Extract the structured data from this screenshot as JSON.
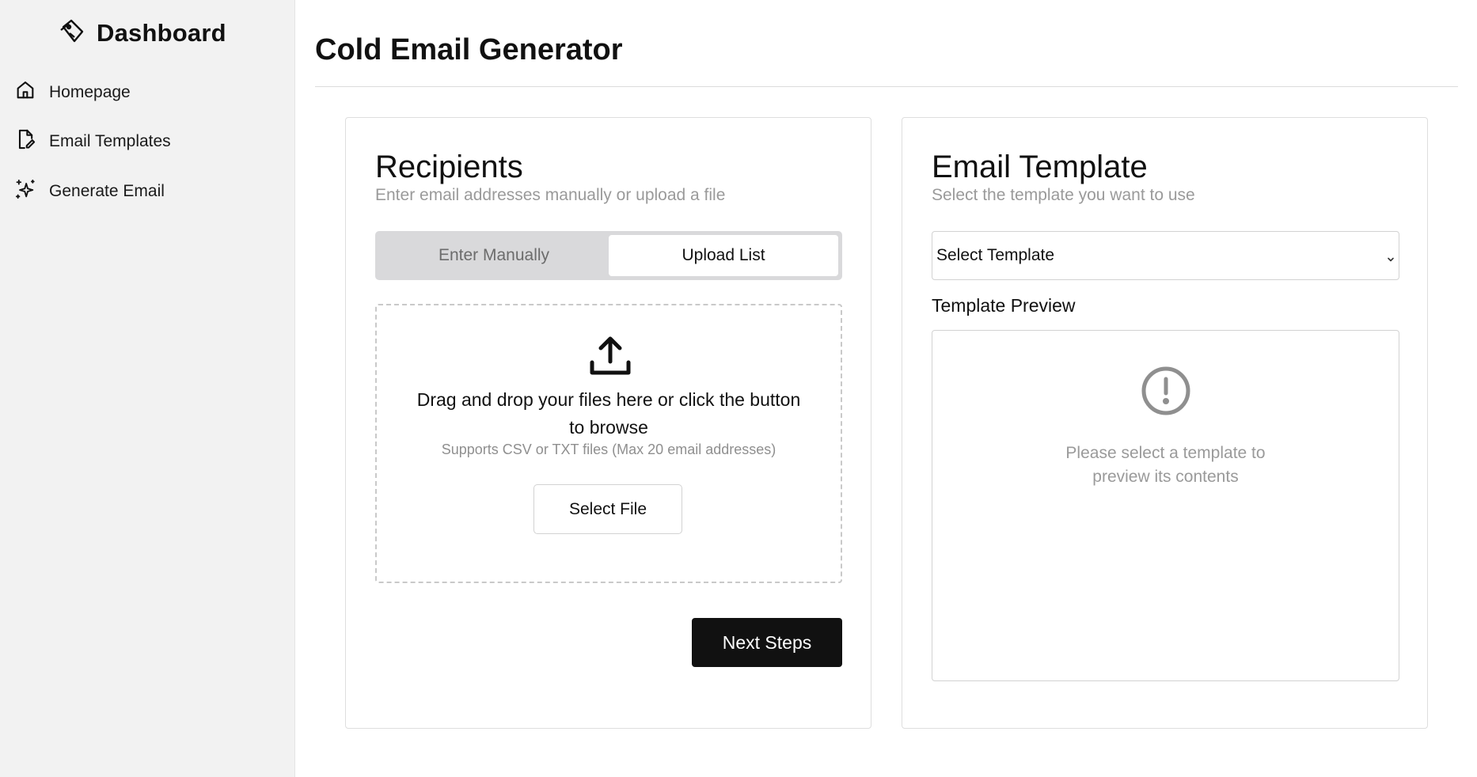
{
  "sidebar": {
    "brand": {
      "title": "Dashboard",
      "icon": "tag-logo-icon"
    },
    "items": [
      {
        "label": "Homepage",
        "icon": "home-icon"
      },
      {
        "label": "Email Templates",
        "icon": "file-edit-icon"
      },
      {
        "label": "Generate Email",
        "icon": "sparkles-icon"
      }
    ]
  },
  "main": {
    "title": "Cold Email Generator",
    "recipients": {
      "title": "Recipients",
      "subtitle": "Enter email addresses manually or upload a file",
      "tabs": [
        {
          "label": "Enter Manually",
          "active": false
        },
        {
          "label": "Upload List",
          "active": true
        }
      ],
      "dropzone": {
        "icon": "upload-icon",
        "main_text": "Drag and drop your files here or click the button to browse",
        "sub_text": "Supports CSV or TXT files (Max 20 email addresses)",
        "button_label": "Select File"
      },
      "next_label": "Next Steps"
    },
    "template": {
      "title": "Email Template",
      "subtitle": "Select the template you want to use",
      "select_value": "Select Template",
      "preview_label": "Template Preview",
      "preview_icon": "alert-circle-icon",
      "preview_empty": "Please select a template to preview its contents"
    }
  },
  "colors": {
    "sidebar_bg": "#f2f2f2",
    "primary_button": "#111111",
    "muted_text": "#9a9a9a",
    "toggle_bg": "#d9d9db"
  }
}
